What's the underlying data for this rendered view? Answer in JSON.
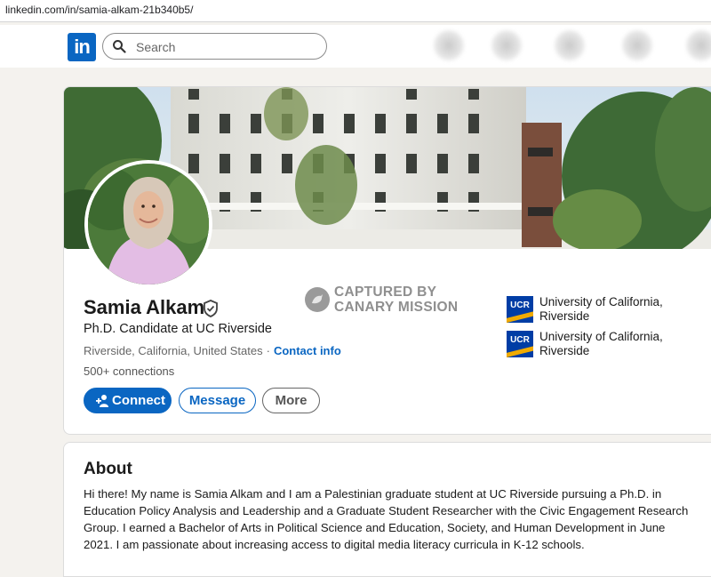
{
  "browser": {
    "url": "linkedin.com/in/samia-alkam-21b340b5/"
  },
  "nav": {
    "logo_text": "in",
    "search_placeholder": "Search",
    "brand_color": "#0a66c2"
  },
  "profile": {
    "name": "Samia Alkam",
    "headline": "Ph.D. Candidate at UC Riverside",
    "location": "Riverside, California, United States",
    "location_separator": "·",
    "contact_info_label": "Contact info",
    "connections": "500+ connections",
    "actions": {
      "connect": "Connect",
      "message": "Message",
      "more": "More"
    },
    "education": [
      {
        "logo_text": "UCR",
        "name": "University of California, Riverside"
      },
      {
        "logo_text": "UCR",
        "name": "University of California, Riverside"
      }
    ]
  },
  "watermark": {
    "line1": "CAPTURED BY",
    "line2": "CANARY MISSION"
  },
  "about": {
    "title": "About",
    "text": "Hi there! My name is Samia Alkam and I am a Palestinian graduate student at UC Riverside pursuing a Ph.D. in Education Policy Analysis and Leadership and a Graduate Student Researcher with the Civic Engagement Research Group. I earned a Bachelor of Arts in Political Science and Education, Society, and Human Development in June 2021. I am passionate about increasing access to digital media literacy curricula in K-12 schools."
  },
  "icons": {
    "search": "search-icon",
    "verified": "verified-shield-icon",
    "connect": "add-person-icon",
    "watermark_seal": "canary-bird-icon"
  }
}
